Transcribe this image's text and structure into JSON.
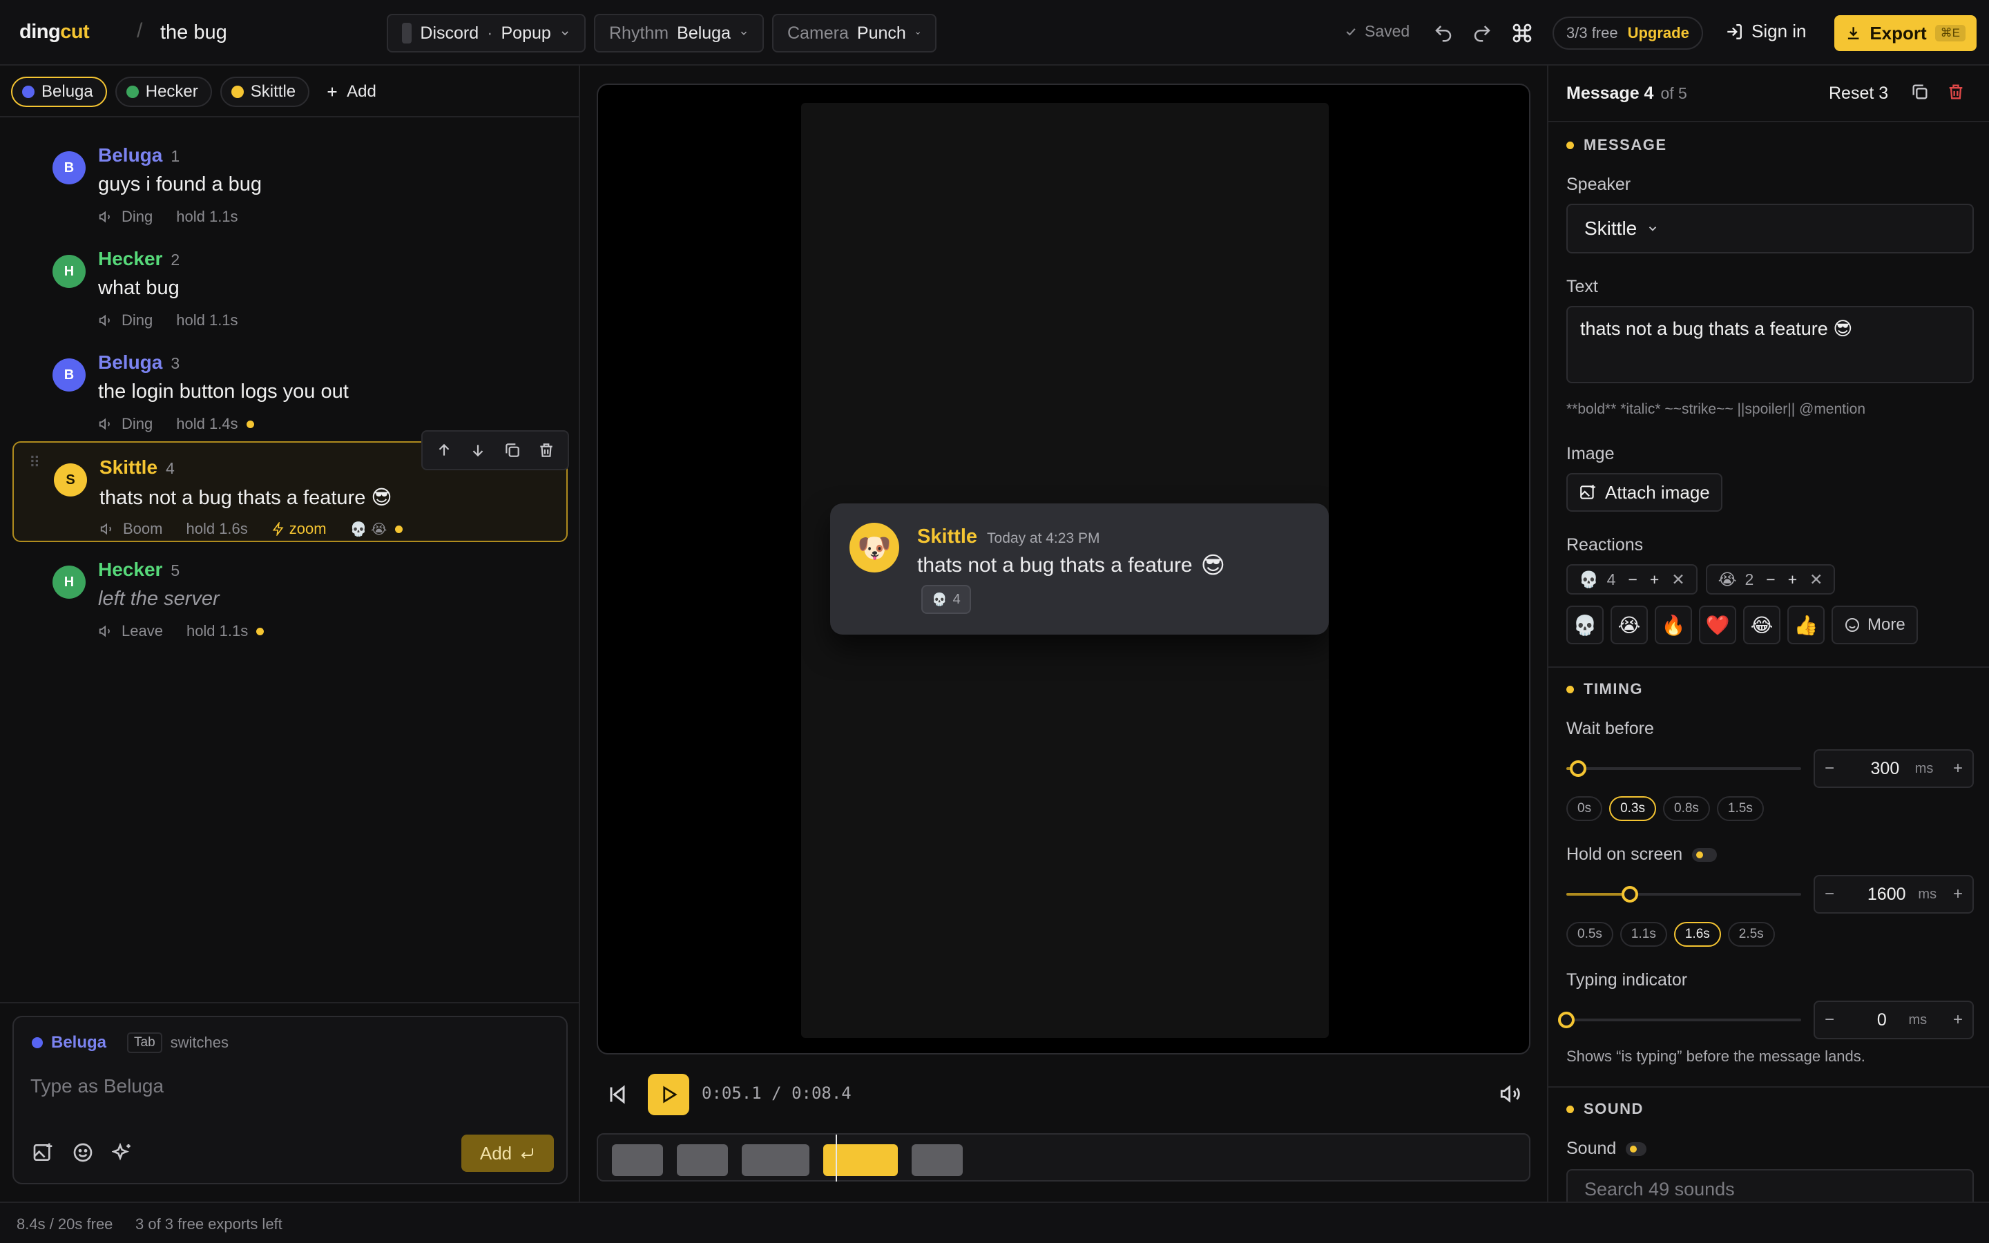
{
  "app": {
    "logo_a": "ding",
    "logo_b": "cut",
    "separator": "/",
    "project_title": "the bug"
  },
  "toolbar": {
    "platform": "Discord",
    "sep": "·",
    "style": "Popup",
    "rhythm_label": "Rhythm",
    "rhythm_value": "Beluga",
    "camera_label": "Camera",
    "camera_value": "Punch",
    "saved": "Saved",
    "free_count": "3/3 free",
    "upgrade": "Upgrade",
    "sign_in": "Sign in",
    "export": "Export",
    "export_kbd": "⌘E"
  },
  "speakers": [
    {
      "name": "Beluga",
      "color": "#5865f2"
    },
    {
      "name": "Hecker",
      "color": "#3ba55d"
    },
    {
      "name": "Skittle",
      "color": "#f5c532"
    }
  ],
  "add_speaker": "Add",
  "messages": [
    {
      "initial": "B",
      "name": "Beluga",
      "index": "1",
      "text": "guys i found a bug",
      "sound": "Ding",
      "hold": "hold 1.1s"
    },
    {
      "initial": "H",
      "name": "Hecker",
      "index": "2",
      "text": "what bug",
      "sound": "Ding",
      "hold": "hold 1.1s"
    },
    {
      "initial": "B",
      "name": "Beluga",
      "index": "3",
      "text": "the login button logs you out",
      "sound": "Ding",
      "hold": "hold 1.4s"
    },
    {
      "initial": "S",
      "name": "Skittle",
      "index": "4",
      "text": "thats not a bug thats a feature 😎",
      "sound": "Boom",
      "hold": "hold 1.6s",
      "effect": "zoom",
      "reactions": "💀 😭"
    },
    {
      "initial": "H",
      "name": "Hecker",
      "index": "5",
      "text": "left the server",
      "sound": "Leave",
      "hold": "hold 1.1s"
    }
  ],
  "composer": {
    "speaker": "Beluga",
    "tab_kbd": "Tab",
    "switches": "switches",
    "placeholder": "Type as Beluga",
    "add": "Add"
  },
  "preview": {
    "name": "Skittle",
    "time": "Today at 4:23 PM",
    "text": "thats not a bug thats a feature",
    "emoji": "😎",
    "reaction_emoji": "💀",
    "reaction_count": "4",
    "avatar_emoji": "🐶"
  },
  "player": {
    "current": "0:05.1",
    "sep": "/",
    "total": "0:08.4",
    "progress": 0.607
  },
  "inspector": {
    "title": "Message 4",
    "of": "of 5",
    "reset": "Reset 3",
    "section_message": "MESSAGE",
    "speaker_label": "Speaker",
    "speaker_value": "Skittle",
    "text_label": "Text",
    "text_value": "thats not a bug thats a feature 😎",
    "format_hint": "**bold** *italic* ~~strike~~ ||spoiler|| @mention",
    "image_label": "Image",
    "attach": "Attach image",
    "reactions_label": "Reactions",
    "reactions": [
      {
        "emoji": "💀",
        "count": "4"
      },
      {
        "emoji": "😭",
        "count": "2"
      }
    ],
    "quick_emojis": [
      "💀",
      "😭",
      "🔥",
      "❤️",
      "😂",
      "👍"
    ],
    "more": "More",
    "section_timing": "TIMING",
    "wait_label": "Wait before",
    "wait_value": "300",
    "wait_fraction": 0.05,
    "wait_presets": [
      "0s",
      "0.3s",
      "0.8s",
      "1.5s"
    ],
    "hold_label": "Hold on screen",
    "hold_value": "1600",
    "hold_fraction": 0.27,
    "hold_presets": [
      "0.5s",
      "1.1s",
      "1.6s",
      "2.5s"
    ],
    "typing_label": "Typing indicator",
    "typing_value": "0",
    "typing_fraction": 0,
    "typing_hint": "Shows “is typing” before the message lands.",
    "unit": "ms",
    "section_sound": "SOUND",
    "sound_label": "Sound",
    "sound_placeholder": "Search 49 sounds"
  },
  "status": {
    "duration": "8.4s / 20s free",
    "exports": "3 of 3 free exports left"
  }
}
